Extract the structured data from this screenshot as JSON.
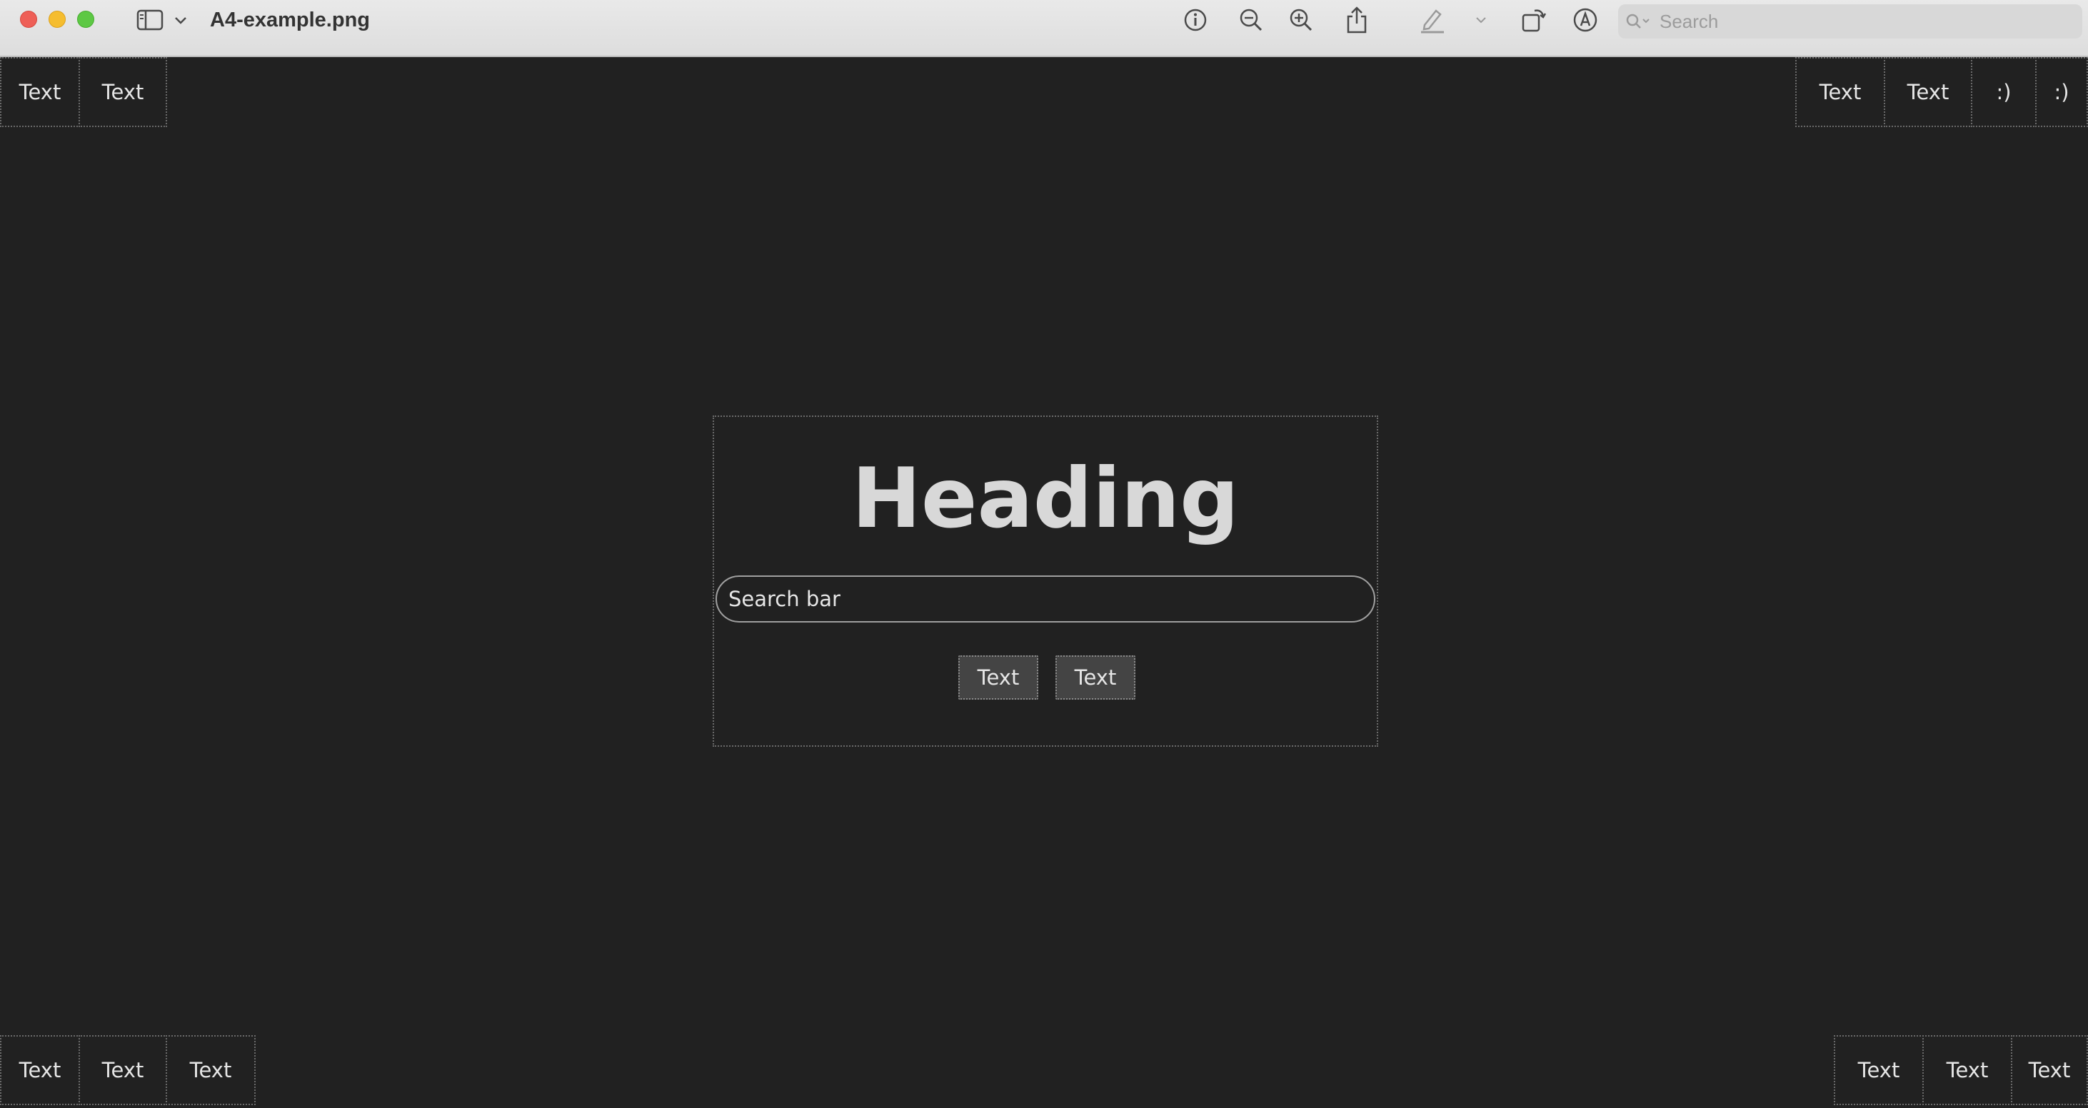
{
  "window": {
    "title": "A4-example.png",
    "search_placeholder": "Search"
  },
  "toolbar": {
    "icons": [
      "sidebar-icon",
      "chevron-down-icon",
      "info-icon",
      "zoom-out-icon",
      "zoom-in-icon",
      "share-icon",
      "highlight-pen-icon",
      "chevron-down-icon",
      "rotate-icon",
      "markup-icon",
      "search-icon"
    ]
  },
  "page": {
    "top_left": [
      "Text",
      "Text"
    ],
    "top_right": [
      "Text",
      "Text",
      ":)",
      ":)"
    ],
    "bottom_left": [
      "Text",
      "Text",
      "Text"
    ],
    "bottom_right": [
      "Text",
      "Text",
      "Text"
    ],
    "center": {
      "heading": "Heading",
      "search_placeholder": "Search bar",
      "buttons": [
        "Text",
        "Text"
      ]
    }
  },
  "colors": {
    "background": "#212121",
    "text": "#e6e6e6",
    "heading": "#d8d8d8",
    "button_bg": "#444444"
  }
}
